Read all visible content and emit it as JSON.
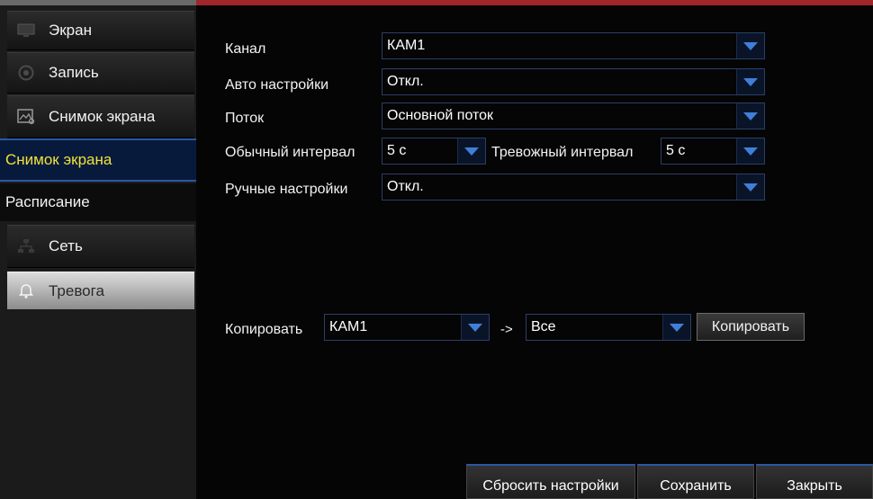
{
  "sidebar": {
    "items": [
      {
        "label": "Экран",
        "icon": "monitor-icon"
      },
      {
        "label": "Запись",
        "icon": "record-icon"
      },
      {
        "label": "Снимок экрана",
        "icon": "snapshot-icon"
      },
      {
        "label": "Снимок экрана"
      },
      {
        "label": "Расписание"
      },
      {
        "label": "Сеть",
        "icon": "network-icon"
      },
      {
        "label": "Тревога",
        "icon": "alarm-bell-icon"
      }
    ]
  },
  "form": {
    "channel": {
      "label": "Канал",
      "value": "КАМ1"
    },
    "auto": {
      "label": "Авто настройки",
      "value": "Откл."
    },
    "stream": {
      "label": "Поток",
      "value": "Основной поток"
    },
    "normal_interval": {
      "label": "Обычный интервал",
      "value": "5 с"
    },
    "alarm_interval": {
      "label": "Тревожный интервал",
      "value": "5 с"
    },
    "manual": {
      "label": "Ручные настройки",
      "value": "Откл."
    }
  },
  "copy": {
    "label": "Копировать",
    "from": "КАМ1",
    "arrow": "->",
    "to": "Все",
    "button": "Копировать"
  },
  "buttons": {
    "reset": "Сбросить настройки",
    "save": "Сохранить",
    "close": "Закрыть"
  },
  "colors": {
    "accent_blue": "#2c56a4",
    "active_text": "#f0e23a",
    "top_red": "#a0262a"
  }
}
